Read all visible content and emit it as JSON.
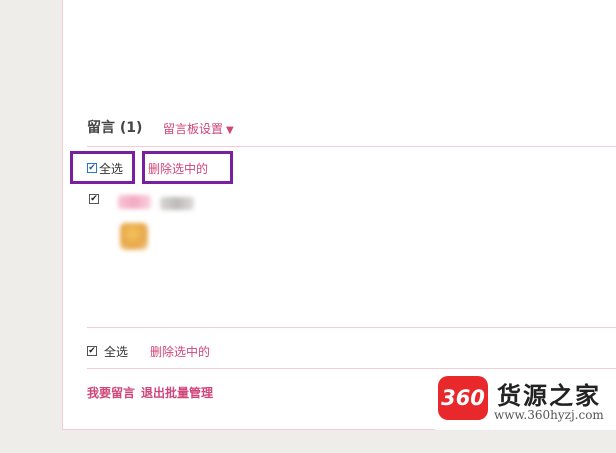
{
  "messages": {
    "title": "留言 (1)",
    "settings_link": "留言板设置",
    "settings_arrow": "▼"
  },
  "top_bar": {
    "select_all_label": "全选",
    "select_all_checked": true,
    "delete_selected": "删除选中的"
  },
  "message_item": {
    "checked": true
  },
  "bottom_bar": {
    "select_all_label": "全选",
    "select_all_checked": true,
    "delete_selected": "删除选中的"
  },
  "footer": {
    "leave_message": "我要留言",
    "exit_batch": "退出批量管理"
  },
  "watermark": {
    "logo_text": "360",
    "brand": "货源之家",
    "url": "www.360hyzj.com",
    "accent_color": "#e8282b"
  },
  "colors": {
    "link": "#d0457a",
    "highlight_box": "#7a1fa0",
    "divider": "#f0cdd8"
  }
}
